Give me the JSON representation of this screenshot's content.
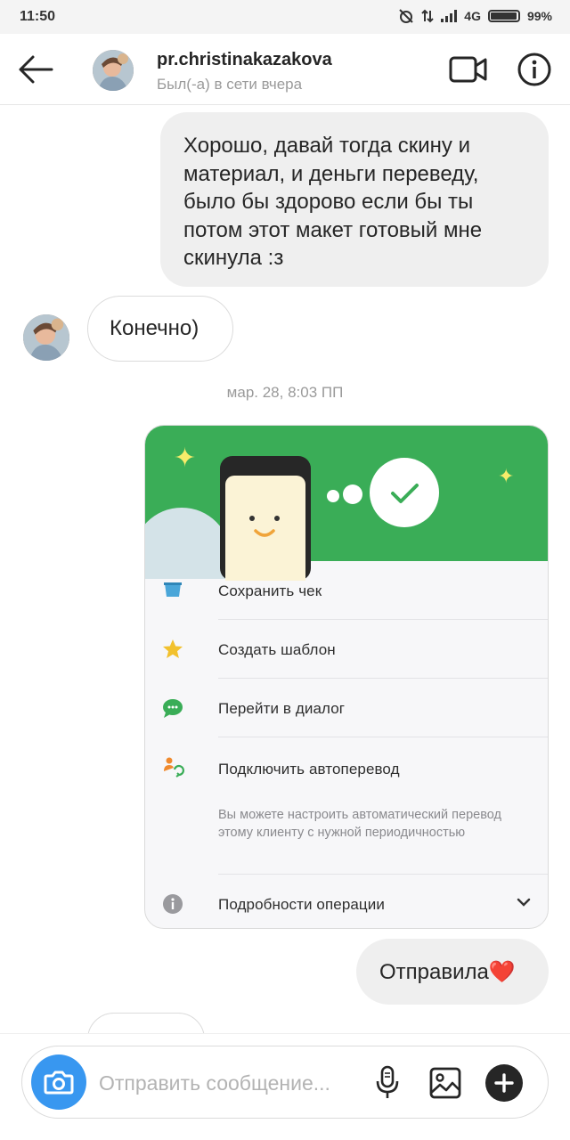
{
  "status_bar": {
    "time": "11:50",
    "network": "4G",
    "battery": "99%"
  },
  "header": {
    "username": "pr.christinakazakova",
    "status": "Был(-а) в сети вчера",
    "icons": [
      "back-arrow-icon",
      "avatar",
      "video-call-icon",
      "info-icon"
    ]
  },
  "messages": {
    "msg1": "Хорошо, давай тогда скину и материал, и деньги переведу, было бы здорово если бы ты потом этот макет готовый мне скинула :з",
    "msg2": "Конечно)",
    "timestamp": "мар. 28, 8:03 ПП",
    "msg3": "Отправила❤️"
  },
  "shared_image": {
    "menu": [
      {
        "label": "Сохранить чек",
        "icon": "receipt-icon"
      },
      {
        "label": "Создать шаблон",
        "icon": "star-icon"
      },
      {
        "label": "Перейти в диалог",
        "icon": "chat-icon"
      },
      {
        "label": "Подключить автоперевод",
        "icon": "autotransfer-icon",
        "description": "Вы можете настроить автоматический перевод этому клиенту с нужной периодичностью"
      },
      {
        "label": "Подробности операции",
        "icon": "info-icon"
      }
    ]
  },
  "composer": {
    "placeholder": "Отправить сообщение..."
  },
  "colors": {
    "accent": "#3897f0",
    "banner_green": "#3aad57",
    "bubble_gray": "#efefef"
  }
}
